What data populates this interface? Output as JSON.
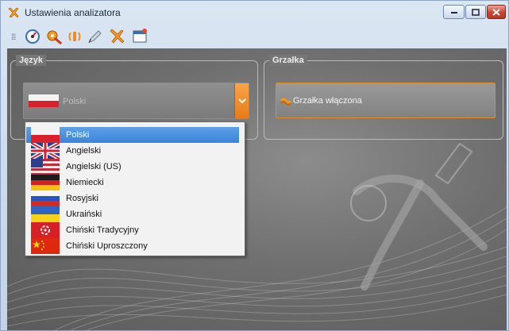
{
  "window": {
    "title": "Ustawienia analizatora",
    "app_icon": "tools-icon",
    "controls": [
      "minimize-icon",
      "maximize-icon",
      "close-icon"
    ]
  },
  "toolbar": {
    "icons": [
      "grip-icon",
      "gauge-icon",
      "language-tools-icon",
      "wireless-icon",
      "pen-icon",
      "tools-icon",
      "window-icon"
    ]
  },
  "language_group": {
    "title": "Język",
    "selected": "Polski",
    "selected_flag": "flag-pl",
    "options": [
      {
        "label": "Polski",
        "flag": "flag-pl",
        "selected": true
      },
      {
        "label": "Angielski",
        "flag": "flag-gb",
        "selected": false
      },
      {
        "label": "Angielski (US)",
        "flag": "flag-us",
        "selected": false
      },
      {
        "label": "Niemiecki",
        "flag": "flag-de",
        "selected": false
      },
      {
        "label": "Rosyjski",
        "flag": "flag-ru",
        "selected": false
      },
      {
        "label": "Ukraiński",
        "flag": "flag-ua",
        "selected": false
      },
      {
        "label": "Chiński Tradycyjny",
        "flag": "flag-hk",
        "selected": false
      },
      {
        "label": "Chiński Uproszczony",
        "flag": "flag-cn",
        "selected": false
      }
    ]
  },
  "heater_group": {
    "title": "Grzałka",
    "button_label": "Grzałka włączona",
    "button_icon": "heater-icon"
  },
  "colors": {
    "accent_orange": "#f08c23",
    "selection_blue": "#3b84d8",
    "client_background": "#6f6f6f"
  }
}
